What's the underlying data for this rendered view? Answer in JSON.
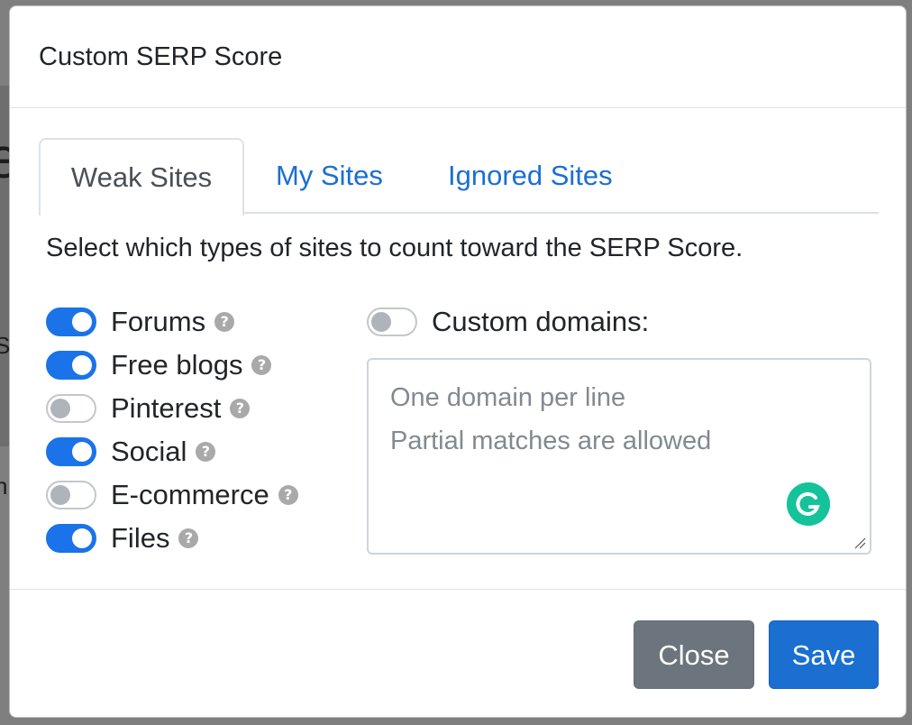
{
  "modal": {
    "title": "Custom SERP Score",
    "tabs": [
      {
        "label": "Weak Sites",
        "active": true
      },
      {
        "label": "My Sites",
        "active": false
      },
      {
        "label": "Ignored Sites",
        "active": false
      }
    ],
    "description": "Select which types of sites to count toward the SERP Score.",
    "site_types": [
      {
        "label": "Forums",
        "enabled": true,
        "icon": "question-circle-icon"
      },
      {
        "label": "Free blogs",
        "enabled": true,
        "icon": "question-circle-icon"
      },
      {
        "label": "Pinterest",
        "enabled": false,
        "icon": "question-circle-icon"
      },
      {
        "label": "Social",
        "enabled": true,
        "icon": "question-circle-icon"
      },
      {
        "label": "E-commerce",
        "enabled": false,
        "icon": "question-circle-icon"
      },
      {
        "label": "Files",
        "enabled": true,
        "icon": "question-circle-icon"
      }
    ],
    "custom_domains": {
      "label": "Custom domains:",
      "enabled": false,
      "placeholder_line1": "One domain per line",
      "placeholder_line2": "Partial matches are allowed"
    },
    "buttons": {
      "close_label": "Close",
      "save_label": "Save"
    },
    "colors": {
      "accent": "#1a73e8",
      "link": "#1a6fd1",
      "close_button": "#6c757d",
      "grammarly": "#15c39a"
    }
  },
  "backdrop": {
    "glyphs": [
      "e",
      "S",
      "n"
    ]
  }
}
